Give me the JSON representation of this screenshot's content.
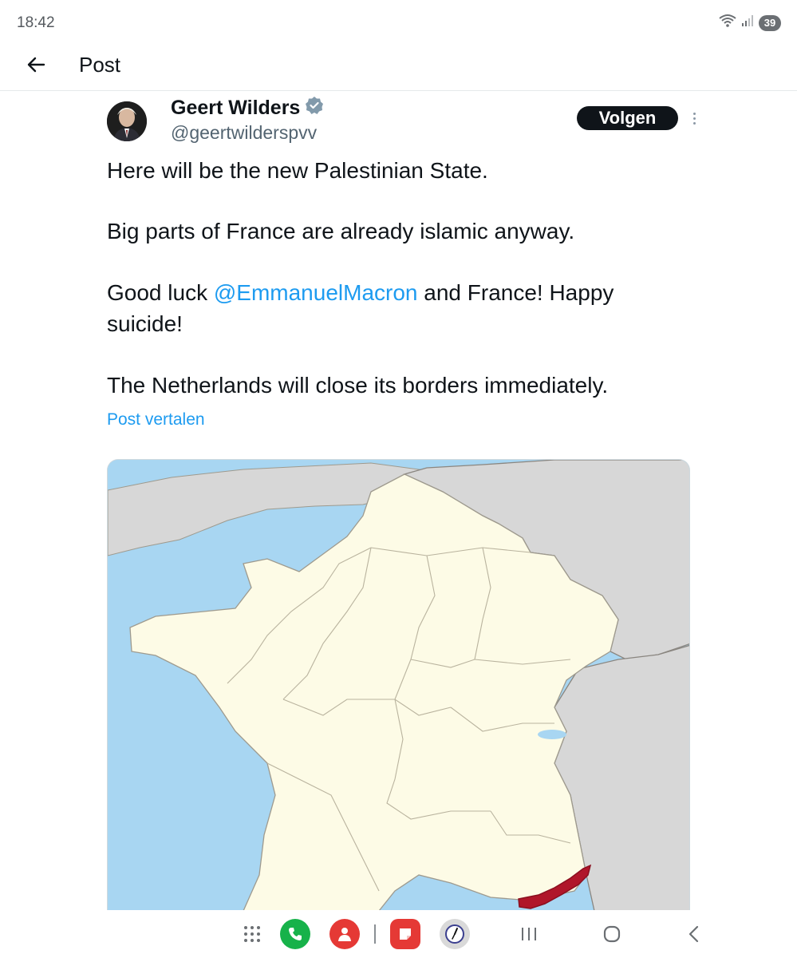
{
  "status_bar": {
    "time": "18:42",
    "battery_level": "39",
    "icons": [
      "wifi-icon",
      "signal-icon",
      "battery-icon"
    ]
  },
  "header": {
    "title": "Post",
    "back_icon": "arrow-left-icon"
  },
  "post": {
    "author": {
      "name": "Geert Wilders",
      "handle": "@geertwilderspvv",
      "verified": true
    },
    "follow_label": "Volgen",
    "text": {
      "line1": "Here will be the new Palestinian State.",
      "line2": "Big parts of France are already islamic anyway.",
      "line3_pre": "Good luck ",
      "line3_mention": "@EmmanuelMacron",
      "line3_post": " and France! Happy",
      "line4": "suicide!",
      "line5": "The Netherlands will close its borders immediately."
    },
    "translate_label": "Post vertalen",
    "media": {
      "type": "map",
      "subject": "France regions, south-east coast highlighted",
      "colors": {
        "sea": "#a8d6f2",
        "land": "#fdfbe6",
        "neighbors": "#d7d7d7",
        "highlight": "#b0162a",
        "borders": "#9e9a8e"
      }
    }
  },
  "nav_bar": {
    "items": [
      "apps-grid-icon",
      "phone-app-icon",
      "contacts-app-icon",
      "notes-app-icon",
      "clock-app-icon",
      "recents-icon",
      "home-icon",
      "back-icon"
    ],
    "colors": {
      "phone": "#17b24a",
      "contacts": "#e53935",
      "notes": "#e53935",
      "clock": "#d9d9d9"
    }
  },
  "colors": {
    "link": "#1d9bf0",
    "text": "#0f1419",
    "secondary": "#536471"
  }
}
